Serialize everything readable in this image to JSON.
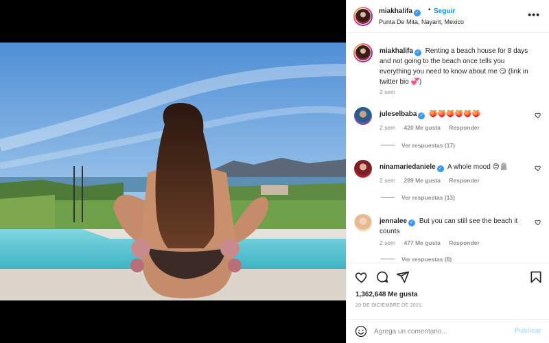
{
  "post": {
    "author": "miakhalifa",
    "follow_label": "Seguir",
    "separator": "•",
    "location": "Punta De Mita, Nayarit, Mexico",
    "more_label": "•••",
    "caption": "Renting a beach house for 8 days and not going to the beach once tells you everything you need to know about me 😏 (link in twitter bio 💞)",
    "caption_age": "2 sem"
  },
  "comments": [
    {
      "username": "juleselbaba",
      "text": "🍑🍑🍑🍑🍑🍑",
      "age": "2 sem",
      "likes": "420 Me gusta",
      "reply_label": "Responder",
      "view_replies": "Ver respuestas (17)"
    },
    {
      "username": "ninamariedaniele",
      "text": "A whole mood 😍🪦",
      "age": "2 sem",
      "likes": "289 Me gusta",
      "reply_label": "Responder",
      "view_replies": "Ver respuestas (13)"
    },
    {
      "username": "jennalee",
      "text": "But you can still see the beach it counts",
      "age": "2 sem",
      "likes": "477 Me gusta",
      "reply_label": "Responder",
      "view_replies": "Ver respuestas (8)"
    }
  ],
  "stats": {
    "likes": "1,362,648 Me gusta",
    "date": "20 DE DICIEMBRE DE 2021"
  },
  "composer": {
    "placeholder": "Agrega un comentario...",
    "post_label": "Publicar"
  },
  "colors": {
    "accent": "#0095f6",
    "verified": "#3897f0",
    "muted": "#8e8e8e",
    "post_disabled": "#b2dffc"
  },
  "icons": [
    "verified-badge-icon",
    "more-options-icon",
    "heart-icon",
    "comment-icon",
    "share-icon",
    "save-bookmark-icon",
    "emoji-icon"
  ]
}
